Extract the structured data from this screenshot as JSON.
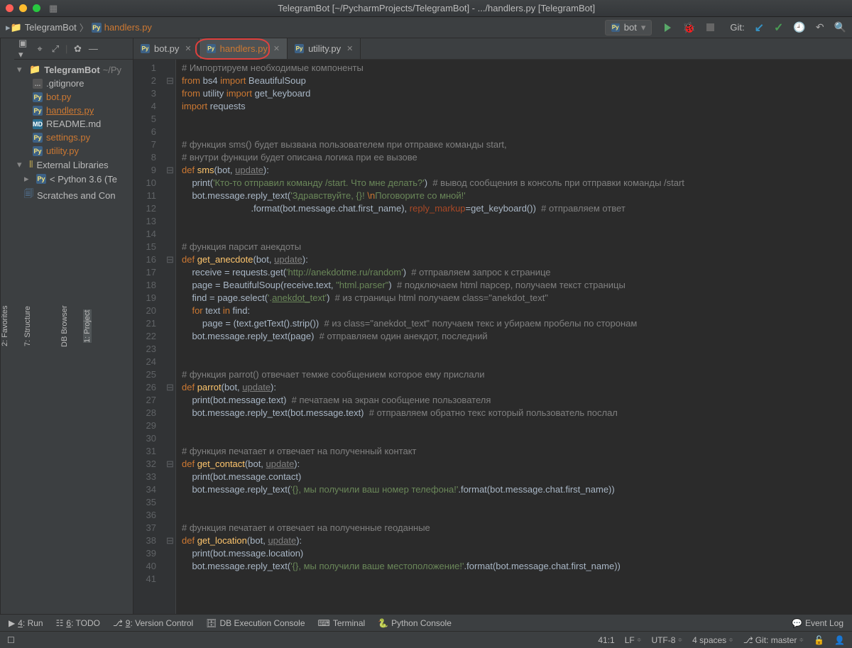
{
  "title": "TelegramBot [~/PycharmProjects/TelegramBot] - .../handlers.py [TelegramBot]",
  "breadcrumb": {
    "root": "TelegramBot",
    "file": "handlers.py"
  },
  "run_config": {
    "label": "bot"
  },
  "git_label": "Git:",
  "side_tabs": {
    "project": "1: Project",
    "db": "DB Browser",
    "structure": "7: Structure",
    "favorites": "2: Favorites"
  },
  "project_tree": {
    "root": "TelegramBot",
    "root_loc": "~/Py",
    "items": [
      {
        "name": ".gitignore",
        "kind": "git"
      },
      {
        "name": "bot.py",
        "kind": "py",
        "orange": true
      },
      {
        "name": "handlers.py",
        "kind": "py",
        "color": "sel-under"
      },
      {
        "name": "README.md",
        "kind": "md"
      },
      {
        "name": "settings.py",
        "kind": "py",
        "orange": true
      },
      {
        "name": "utility.py",
        "kind": "py",
        "orange": true
      }
    ],
    "external": "External Libraries",
    "python": "< Python 3.6 (Te",
    "scratches": "Scratches and Con"
  },
  "editor_tabs": [
    {
      "label": "bot.py"
    },
    {
      "label": "handlers.py",
      "active": true,
      "highlighted": true
    },
    {
      "label": "utility.py"
    }
  ],
  "code_lines_count": 41,
  "code": [
    [
      [
        "cm",
        "# Импортируем необходимые компоненты"
      ]
    ],
    [
      [
        "kw",
        "from"
      ],
      [
        "",
        " bs4 "
      ],
      [
        "kw",
        "import"
      ],
      [
        "",
        " BeautifulSoup"
      ]
    ],
    [
      [
        "kw",
        "from"
      ],
      [
        "",
        " utility "
      ],
      [
        "kw",
        "import"
      ],
      [
        "",
        " get_keyboard"
      ]
    ],
    [
      [
        "kw",
        "import"
      ],
      [
        "",
        " requests"
      ]
    ],
    [],
    [],
    [
      [
        "cm",
        "# функция sms() будет вызвана пользователем при отправке команды start,"
      ]
    ],
    [
      [
        "cm",
        "# внутри функции будет описана логика при ее вызове"
      ]
    ],
    [
      [
        "kw",
        "def "
      ],
      [
        "fn",
        "sms"
      ],
      [
        "",
        "(bot, "
      ],
      [
        "arg-u",
        "update"
      ],
      [
        "",
        "):"
      ]
    ],
    [
      [
        "",
        "    print("
      ],
      [
        "sg",
        "'Кто-то отправил команду /start. Что мне делать?'"
      ],
      [
        "",
        ")  "
      ],
      [
        "cm",
        "# вывод сообщения в консоль при отправки команды /start"
      ]
    ],
    [
      [
        "",
        "    bot.message.reply_text("
      ],
      [
        "sg",
        "'Здравствуйте, {}! "
      ],
      [
        "esc",
        "\\n"
      ],
      [
        "sg",
        "Поговорите со мной!'"
      ]
    ],
    [
      [
        "",
        "                           .format(bot.message.chat.first_name), "
      ],
      [
        "par-k",
        "reply_markup"
      ],
      [
        "",
        "=get_keyboard())  "
      ],
      [
        "cm",
        "# отправляем ответ"
      ]
    ],
    [],
    [],
    [
      [
        "cm",
        "# функция парсит анекдоты"
      ]
    ],
    [
      [
        "kw",
        "def "
      ],
      [
        "fn",
        "get_anecdote"
      ],
      [
        "",
        "(bot, "
      ],
      [
        "arg-u",
        "update"
      ],
      [
        "",
        "):"
      ]
    ],
    [
      [
        "",
        "    receive = requests.get("
      ],
      [
        "sg",
        "'http://anekdotme.ru/random'"
      ],
      [
        "",
        ")  "
      ],
      [
        "cm",
        "# отправляем запрос к странице"
      ]
    ],
    [
      [
        "",
        "    page = BeautifulSoup(receive.text, "
      ],
      [
        "sg",
        "\"html.parser\""
      ],
      [
        "",
        ")  "
      ],
      [
        "cm",
        "# подключаем html парсер, получаем текст страницы"
      ]
    ],
    [
      [
        "",
        "    find = page.select("
      ],
      [
        "sg",
        "'."
      ],
      [
        "sg-u",
        "anekdot_"
      ],
      [
        "sg",
        "text'"
      ],
      [
        "",
        ")  "
      ],
      [
        "cm",
        "# из страницы html получаем class=\""
      ],
      [
        "cm",
        "anekdot_text\""
      ]
    ],
    [
      [
        "",
        "    "
      ],
      [
        "kw",
        "for"
      ],
      [
        "",
        " text "
      ],
      [
        "kw",
        "in"
      ],
      [
        "",
        " find:"
      ]
    ],
    [
      [
        "",
        "        page = (text.getText().strip())  "
      ],
      [
        "cm",
        "# из class=\"anekdot_text\" получаем текс и убираем пробелы по сторонам"
      ]
    ],
    [
      [
        "",
        "    bot.message.reply_text(page)  "
      ],
      [
        "cm",
        "# отправляем один анекдот, последний"
      ]
    ],
    [],
    [],
    [
      [
        "cm",
        "# функция parrot() отвечает темже сообщением которое ему прислали"
      ]
    ],
    [
      [
        "kw",
        "def "
      ],
      [
        "fn",
        "parrot"
      ],
      [
        "",
        "(bot, "
      ],
      [
        "arg-u",
        "update"
      ],
      [
        "",
        "):"
      ]
    ],
    [
      [
        "",
        "    print(bot.message.text)  "
      ],
      [
        "cm",
        "# печатаем на экран сообщение пользователя"
      ]
    ],
    [
      [
        "",
        "    bot.message.reply_text(bot.message.text)  "
      ],
      [
        "cm",
        "# отправляем обратно текс который пользователь послал"
      ]
    ],
    [],
    [],
    [
      [
        "cm",
        "# функция печатает и отвечает на полученный контакт"
      ]
    ],
    [
      [
        "kw",
        "def "
      ],
      [
        "fn",
        "get_contact"
      ],
      [
        "",
        "(bot, "
      ],
      [
        "arg-u",
        "update"
      ],
      [
        "",
        "):"
      ]
    ],
    [
      [
        "",
        "    print(bot.message.contact)"
      ]
    ],
    [
      [
        "",
        "    bot.message.reply_text("
      ],
      [
        "sg",
        "'{}, мы получили ваш номер телефона!'"
      ],
      [
        "",
        ".format(bot.message.chat.first_name))"
      ]
    ],
    [],
    [],
    [
      [
        "cm",
        "# функция печатает и отвечает на полученные геоданные"
      ]
    ],
    [
      [
        "kw",
        "def "
      ],
      [
        "fn",
        "get_location"
      ],
      [
        "",
        "(bot, "
      ],
      [
        "arg-u",
        "update"
      ],
      [
        "",
        "):"
      ]
    ],
    [
      [
        "",
        "    print(bot.message.location)"
      ]
    ],
    [
      [
        "",
        "    bot.message.reply_text("
      ],
      [
        "sg",
        "'{}, мы получили ваше местоположение!'"
      ],
      [
        "",
        ".format(bot.message.chat.first_name))"
      ]
    ],
    []
  ],
  "fold_marks": {
    "2": "-",
    "9": "-",
    "16": "-",
    "26": "-",
    "32": "-",
    "38": "-"
  },
  "bottom_bar": {
    "run": "4: Run",
    "todo": "6: TODO",
    "vcs": "9: Version Control",
    "db": "DB Execution Console",
    "terminal": "Terminal",
    "python": "Python Console",
    "event_log": "Event Log"
  },
  "status": {
    "pos": "41:1",
    "line_ending": "LF",
    "encoding": "UTF-8",
    "indent": "4 spaces",
    "branch_label": "Git: master",
    "lock": "🔓"
  }
}
